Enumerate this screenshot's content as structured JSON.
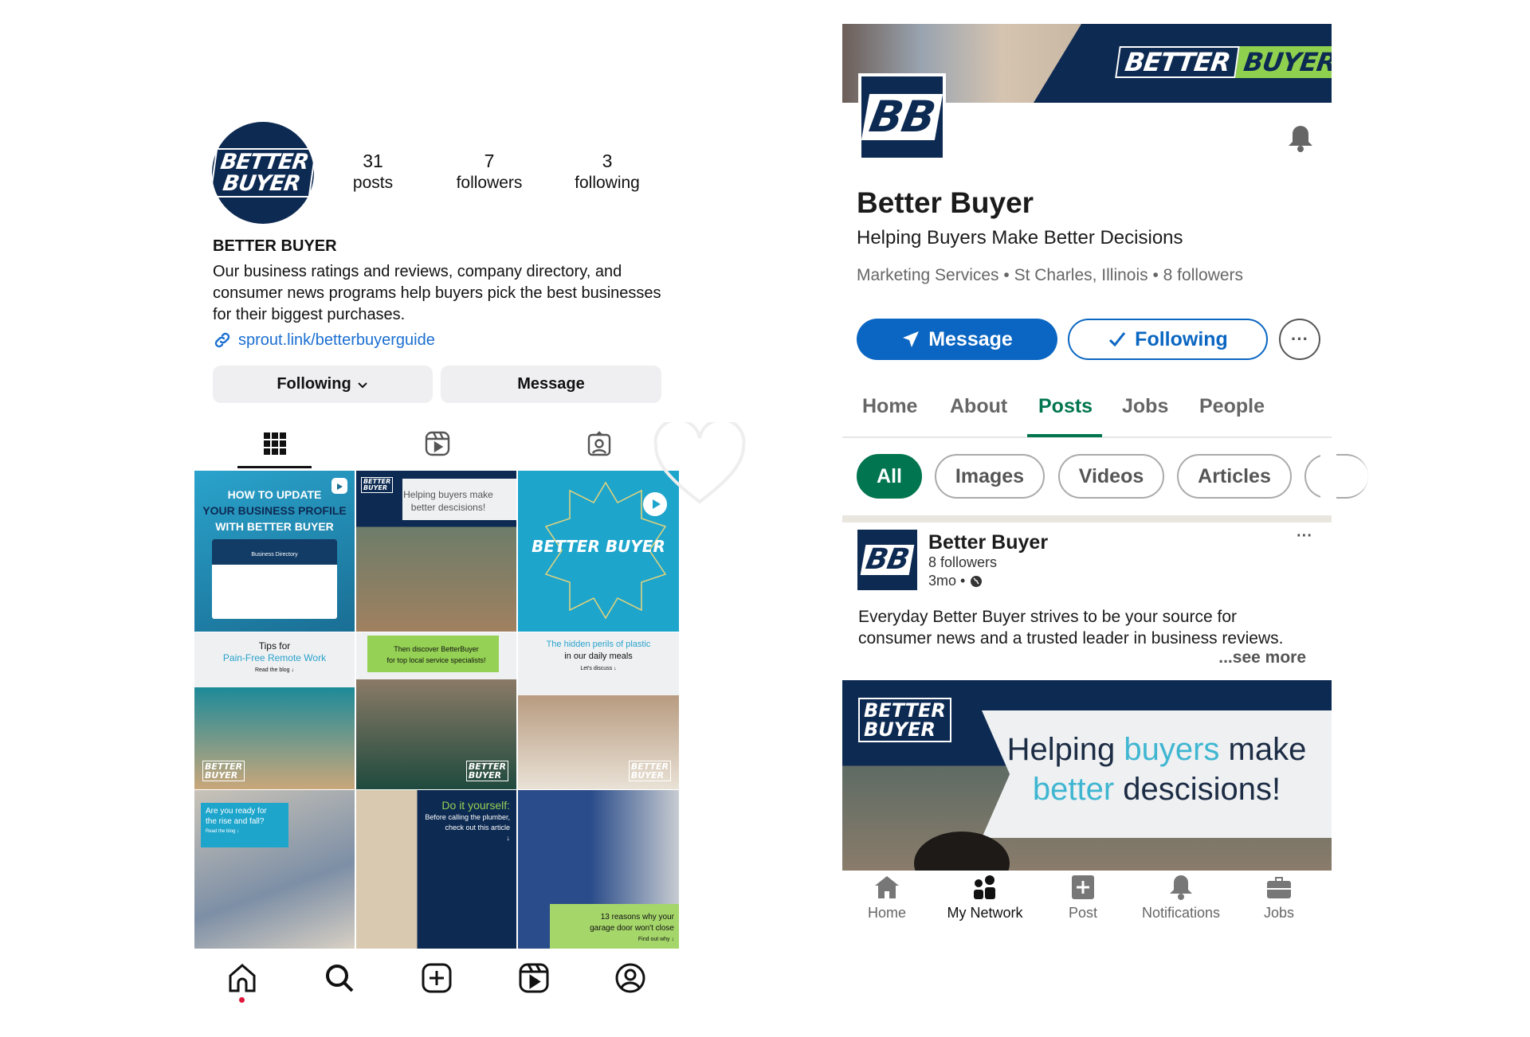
{
  "instagram": {
    "avatar_logo": [
      "BETTER",
      "BUYER"
    ],
    "stats": [
      {
        "value": "31",
        "label": "posts"
      },
      {
        "value": "7",
        "label": "followers"
      },
      {
        "value": "3",
        "label": "following"
      }
    ],
    "name": "BETTER BUYER",
    "bio": "Our business ratings and reviews, company directory, and consumer news programs help buyers pick the best businesses for their biggest purchases.",
    "link": "sprout.link/betterbuyerguide",
    "following_button": "Following",
    "message_button": "Message",
    "tabs": [
      "grid-icon",
      "reels-icon",
      "tagged-icon"
    ],
    "posts": [
      {
        "lines": [
          "HOW TO UPDATE",
          "YOUR BUSINESS PROFILE",
          "WITH BETTER BUYER"
        ],
        "sub": "Business Directory",
        "reel": true
      },
      {
        "lines": [
          "Helping buyers make",
          "better descisions!"
        ],
        "reel": false
      },
      {
        "lines": [
          "BETTER BUYER"
        ],
        "reel": true
      },
      {
        "lines": [
          "Tips for",
          "Pain-Free Remote Work"
        ],
        "sub": "Read the blog ↓",
        "reel": false
      },
      {
        "lines": [
          "Then discover BetterBuyer",
          "for top local service specialists!"
        ],
        "reel": true
      },
      {
        "lines": [
          "The hidden perils of plastic",
          "in our daily meals"
        ],
        "sub": "Let's discuss ↓",
        "reel": false
      },
      {
        "lines": [
          "Are you ready for",
          "the rise and fall?"
        ],
        "sub": "Read the blog ↓",
        "reel": false
      },
      {
        "lines": [
          "Do it yourself:",
          "Before calling the plumber,",
          "check out this article"
        ],
        "sub": "↓",
        "reel": false
      },
      {
        "lines": [
          "13 reasons why your",
          "garage door won't close"
        ],
        "sub": "Find out why ↓",
        "reel": false
      }
    ],
    "bottom_nav": [
      "home-icon",
      "search-icon",
      "create-icon",
      "reels-icon",
      "profile-icon"
    ],
    "colors": {
      "navy": "#0d2a52",
      "link": "#1a6fd1",
      "notification_dot": "#e0163a"
    }
  },
  "linkedin": {
    "banner_logo": [
      "BETTER",
      "BUYER"
    ],
    "logo_initials": "BB",
    "company_name": "Better Buyer",
    "tagline": "Helping Buyers Make Better Decisions",
    "meta": "Marketing Services • St Charles, Illinois • 8 followers",
    "message_button": "Message",
    "following_button": "Following",
    "tabs": [
      {
        "label": "Home",
        "active": false
      },
      {
        "label": "About",
        "active": false
      },
      {
        "label": "Posts",
        "active": true
      },
      {
        "label": "Jobs",
        "active": false
      },
      {
        "label": "People",
        "active": false
      }
    ],
    "filters": [
      {
        "label": "All",
        "active": true
      },
      {
        "label": "Images"
      },
      {
        "label": "Videos"
      },
      {
        "label": "Articles"
      }
    ],
    "post": {
      "author": "Better Buyer",
      "followers": "8 followers",
      "time": "3mo •",
      "text": "Everyday Better Buyer strives to be your source for consumer news and a trusted leader in business reviews.",
      "see_more": "...see more",
      "image_headline_1": "Helping ",
      "image_highlight_1": "buyers",
      "image_headline_2": " make",
      "image_highlight_2": "better",
      "image_headline_3": " descisions!",
      "image_logo": [
        "BETTER",
        "BUYER"
      ]
    },
    "bottom_nav": [
      {
        "label": "Home",
        "icon": "home-icon"
      },
      {
        "label": "My Network",
        "icon": "network-icon",
        "active": true
      },
      {
        "label": "Post",
        "icon": "post-icon"
      },
      {
        "label": "Notifications",
        "icon": "bell-icon"
      },
      {
        "label": "Jobs",
        "icon": "briefcase-icon"
      }
    ],
    "colors": {
      "blue": "#0a66c2",
      "green": "#01754f",
      "navy": "#0d2a52",
      "accent_lime": "#8fd14f"
    }
  }
}
